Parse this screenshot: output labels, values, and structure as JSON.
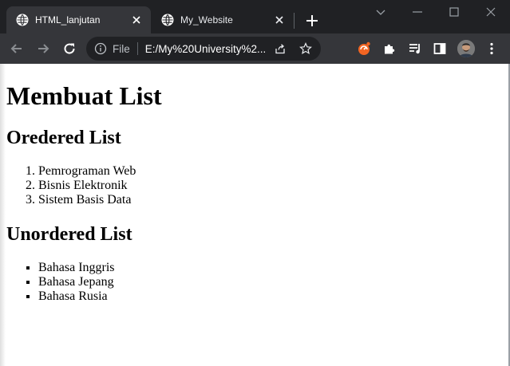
{
  "browser": {
    "tabs": [
      {
        "title": "HTML_lanjutan",
        "active": true
      },
      {
        "title": "My_Website",
        "active": false
      }
    ],
    "address_bar": {
      "scheme_label": "File",
      "url": "E:/My%20University%2..."
    },
    "colors": {
      "titlebar": "#202124",
      "toolbar": "#35363a",
      "omnibox": "#202124",
      "extension_accent": "#f26522"
    }
  },
  "page": {
    "heading": "Membuat List",
    "ordered_heading": "Oredered List",
    "ordered_items": [
      "Pemrograman Web",
      "Bisnis Elektronik",
      "Sistem Basis Data"
    ],
    "unordered_heading": "Unordered List",
    "unordered_items": [
      "Bahasa Inggris",
      "Bahasa Jepang",
      "Bahasa Rusia"
    ]
  }
}
